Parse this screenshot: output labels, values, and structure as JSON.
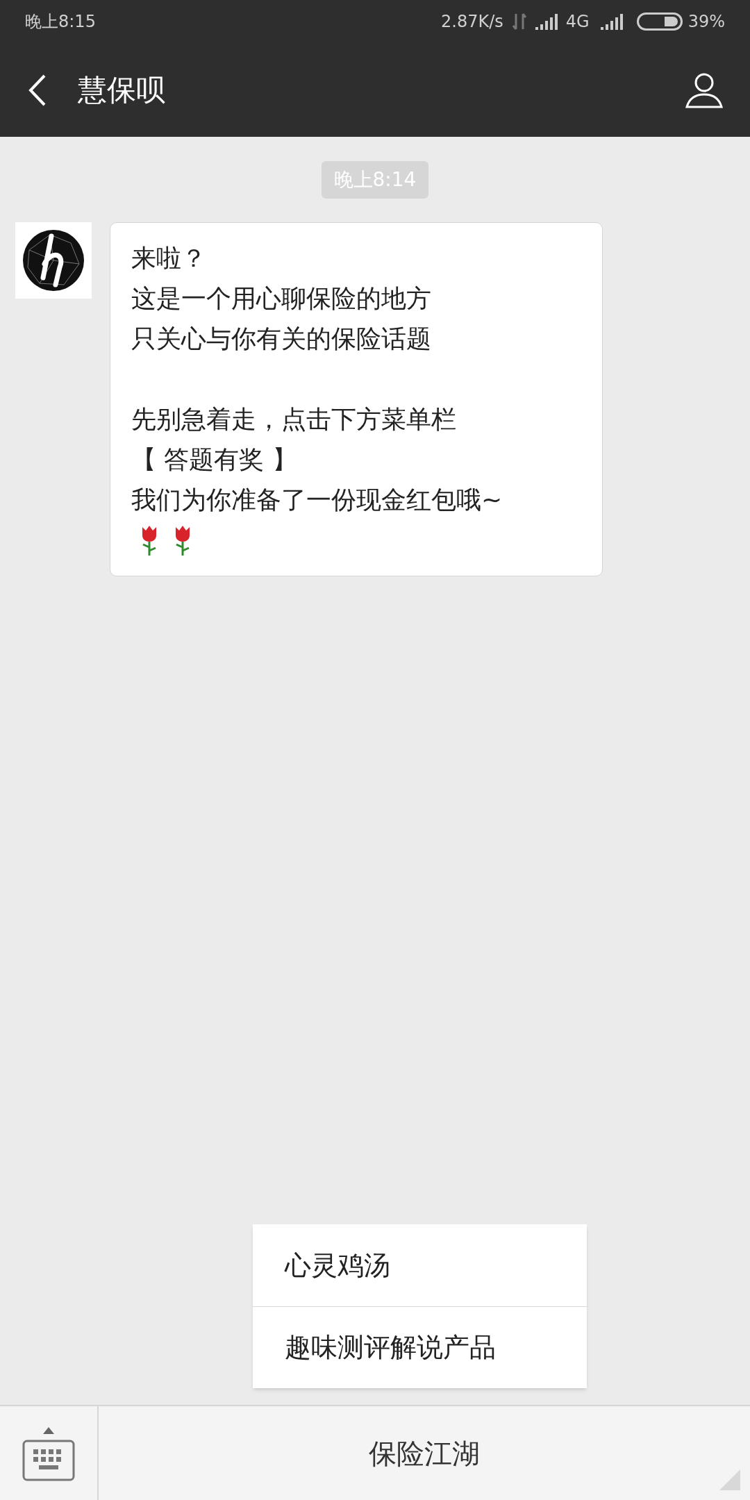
{
  "status_bar": {
    "time": "晚上8:15",
    "speed": "2.87K/s",
    "network": "4G",
    "battery": "39%"
  },
  "header": {
    "title": "慧保呗"
  },
  "chat": {
    "timestamp": "晚上8:14",
    "message_paragraphs": [
      [
        "来啦？",
        "这是一个用心聊保险的地方",
        "只关心与你有关的保险话题"
      ],
      [
        "先别急着走，点击下方菜单栏",
        "【 答题有奖 】",
        "我们为你准备了一份现金红包哦~"
      ]
    ]
  },
  "menu_button": {
    "label": "保险江湖",
    "expanded": true,
    "submenu": [
      "心灵鸡汤",
      "趣味测评解说产品"
    ]
  }
}
